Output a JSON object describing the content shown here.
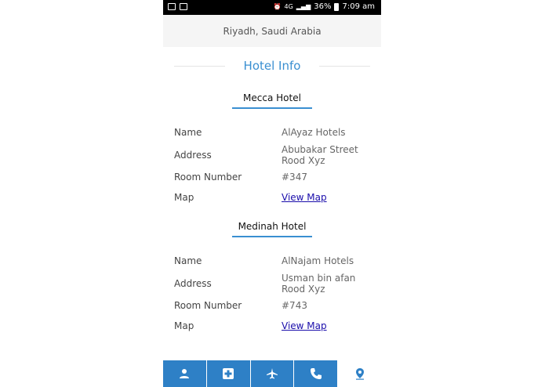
{
  "status_bar": {
    "network": "4G",
    "battery": "36%",
    "time": "7:09 am"
  },
  "location_bar": {
    "text": "Riyadh, Saudi Arabia"
  },
  "section_title": "Hotel Info",
  "hotels": [
    {
      "name": "Mecca Hotel",
      "rows": [
        {
          "label": "Name",
          "value": "AlAyaz Hotels"
        },
        {
          "label": "Address",
          "value_line1": "Abubakar Street",
          "value_line2": "Rood Xyz"
        },
        {
          "label": "Room Number",
          "value": "#347"
        },
        {
          "label": "Map",
          "value": "View Map"
        }
      ]
    },
    {
      "name": "Medinah Hotel",
      "rows": [
        {
          "label": "Name",
          "value": "AlNajam Hotels"
        },
        {
          "label": "Address",
          "value_line1": "Usman bin afan",
          "value_line2": "Rood Xyz"
        },
        {
          "label": "Room Number",
          "value": "#743"
        },
        {
          "label": "Map",
          "value": "View Map"
        }
      ]
    }
  ],
  "bottom_nav": {
    "items": [
      {
        "icon": "person-icon",
        "active": false
      },
      {
        "icon": "medical-plus-icon",
        "active": false
      },
      {
        "icon": "airplane-icon",
        "active": false
      },
      {
        "icon": "phone-icon",
        "active": false
      },
      {
        "icon": "location-pin-icon",
        "active": true
      }
    ]
  },
  "colors": {
    "accent": "#3a8fd1",
    "nav_bar": "#2e80c6",
    "link": "#1a0dab"
  }
}
